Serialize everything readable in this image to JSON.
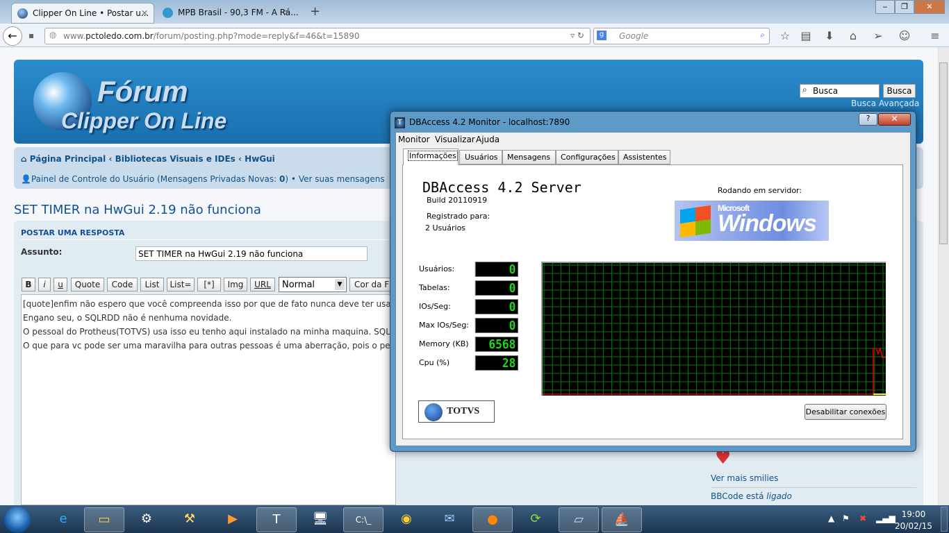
{
  "browser": {
    "tabs": [
      {
        "title": "Clipper On Line • Postar u...",
        "active": true
      },
      {
        "title": "MPB Brasil - 90,3 FM - A Rá...",
        "active": false
      }
    ],
    "url_domain": "www.pctoledo.com.br",
    "url_host_prefix": "www.",
    "url_host": "pctoledo.com.br",
    "url_path": "/forum/posting.php?mode=reply&f=46&t=15890",
    "search_placeholder": "Google"
  },
  "forum": {
    "logo_line1": "Fórum",
    "logo_line2": "Clipper On Line",
    "search_value": "Busca",
    "search_button": "Busca",
    "advanced_search": "Busca Avançada",
    "breadcrumbs": [
      "Página Principal",
      "Bibliotecas Visuais e IDEs",
      "HwGui"
    ],
    "crumb_sep": "‹",
    "ucp_text": "Painel de Controle do Usuário (Mensagens Privadas Novas: ",
    "ucp_count": "0",
    "ucp_close": ")",
    "ucp_sep": "•",
    "view_messages": "Ver suas mensagens",
    "topic_title": "SET TIMER na HwGui 2.19 não funciona",
    "post_heading": "POSTAR UMA RESPOSTA",
    "subject_label": "Assunto:",
    "subject_value": "SET TIMER na HwGui 2.19 não funciona",
    "bbcode_buttons": [
      "B",
      "i",
      "u",
      "Quote",
      "Code",
      "List",
      "List=",
      "[*]",
      "Img",
      "URL"
    ],
    "font_size_select": "Normal",
    "color_button": "Cor da F",
    "message_lines": [
      "[quote]enfim não espero que você compreenda isso por que de fato nunca deve ter usado",
      "Engano seu, o SQLRDD não é nenhuma novidade.",
      "O pessoal do Protheus(TOTVS) usa isso eu tenho aqui instalado na minha maquina. SQLRDD",
      "O que para vc pode ser uma maravilha para outras pessoas é uma aberração, pois o pesso"
    ],
    "more_smilies": "Ver mais smilies",
    "bbcode_status_prefix": "BBCode está ",
    "bbcode_status_value": "ligado"
  },
  "dialog": {
    "title": "DBAccess 4.2 Monitor - localhost:7890",
    "help": "?",
    "close": "✕",
    "menu": [
      "Monitor",
      "Visualizar",
      "Ajuda"
    ],
    "tabs": [
      "Informações",
      "Usuários",
      "Mensagens",
      "Configurações",
      "Assistentes"
    ],
    "server_name": "DBAccess 4.2 Server",
    "build": "Build 20110919",
    "registered_label": "Registrado para:",
    "registered_value": "2 Usuários",
    "running_on": "Rodando em servidor:",
    "os_logo_small": "Microsoft",
    "os_logo": "Windows",
    "stats": [
      {
        "label": "Usuários:",
        "value": "0"
      },
      {
        "label": "Tabelas:",
        "value": "0"
      },
      {
        "label": "IOs/Seg:",
        "value": "0"
      },
      {
        "label": "Max IOs/Seg:",
        "value": "0"
      },
      {
        "label": "Memory (KB)",
        "value": "6568"
      },
      {
        "label": "Cpu (%)",
        "value": "28"
      }
    ],
    "brand": "TOTVS",
    "disable_button": "Desabilitar conexões"
  },
  "taskbar": {
    "time": "19:00",
    "date": "20/02/15"
  },
  "colors": {
    "lcd_green": "#1bd61b",
    "grid_green": "#0a7a0a",
    "cpu_line": "#ff0000",
    "header_blue": "#2b8ccd"
  }
}
